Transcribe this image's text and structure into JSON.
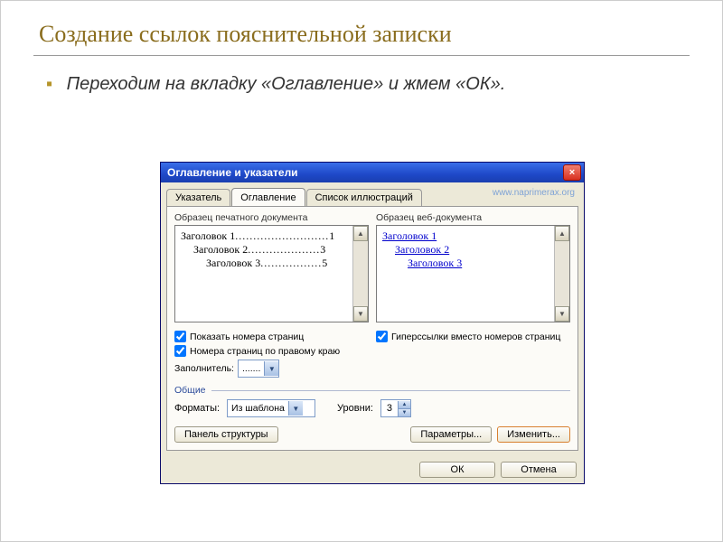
{
  "slide": {
    "title": "Создание ссылок пояснительной записки",
    "bullet": "Переходим на вкладку «Оглавление» и жмем «ОК»."
  },
  "dialog": {
    "title": "Оглавление и указатели",
    "close_x": "×",
    "watermark": "www.naprimerax.org",
    "tabs": [
      "Указатель",
      "Оглавление",
      "Список иллюстраций"
    ],
    "print_label": "Образец печатного документа",
    "web_label": "Образец веб-документа",
    "toc_lines": [
      {
        "text": "Заголовок 1",
        "page": "1",
        "indent": 0
      },
      {
        "text": "Заголовок 2",
        "page": "3",
        "indent": 1
      },
      {
        "text": "Заголовок 3",
        "page": "5",
        "indent": 2
      }
    ],
    "web_lines": [
      "Заголовок 1",
      "Заголовок 2",
      "Заголовок 3"
    ],
    "chk_show_pages": "Показать номера страниц",
    "chk_right_align": "Номера страниц по правому краю",
    "chk_hyperlinks": "Гиперссылки вместо номеров страниц",
    "filler_label": "Заполнитель:",
    "filler_value": ".......",
    "group_common": "Общие",
    "formats_label": "Форматы:",
    "formats_value": "Из шаблона",
    "levels_label": "Уровни:",
    "levels_value": "3",
    "btn_outline": "Панель структуры",
    "btn_params": "Параметры...",
    "btn_modify": "Изменить...",
    "btn_ok": "ОК",
    "btn_cancel": "Отмена"
  }
}
